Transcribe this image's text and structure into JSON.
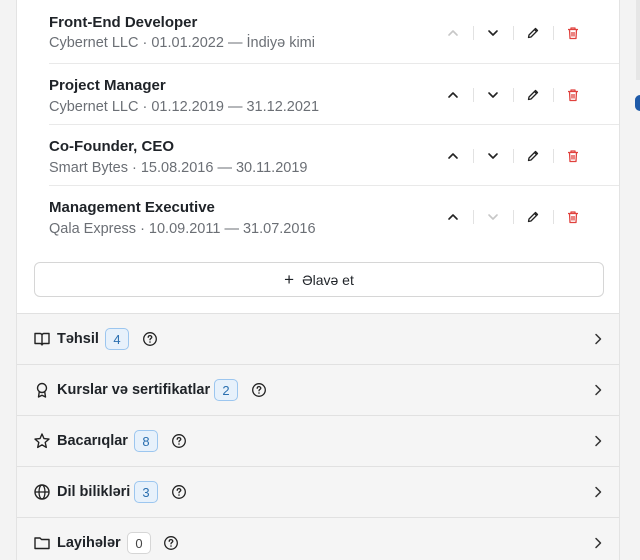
{
  "experience": {
    "items": [
      {
        "title": "Front-End Developer",
        "subtitle": "Cybernet LLC · 01.01.2022 — İndiyə kimi",
        "up_disabled": true,
        "down_disabled": false
      },
      {
        "title": "Project Manager",
        "subtitle": "Cybernet LLC · 01.12.2019 — 31.12.2021",
        "up_disabled": false,
        "down_disabled": false
      },
      {
        "title": "Co-Founder, CEO",
        "subtitle": "Smart Bytes · 15.08.2016 — 30.11.2019",
        "up_disabled": false,
        "down_disabled": false
      },
      {
        "title": "Management Executive",
        "subtitle": "Qala Express · 10.09.2011 — 31.07.2016",
        "up_disabled": false,
        "down_disabled": true
      }
    ],
    "add_label": "Əlavə et"
  },
  "sections": [
    {
      "label": "Təhsil",
      "count": "4",
      "icon": "book-icon"
    },
    {
      "label": "Kurslar və sertifikatlar",
      "count": "2",
      "icon": "award-icon"
    },
    {
      "label": "Bacarıqlar",
      "count": "8",
      "icon": "star-icon"
    },
    {
      "label": "Dil bilikləri",
      "count": "3",
      "icon": "globe-icon"
    },
    {
      "label": "Layihələr",
      "count": "0",
      "icon": "folder-icon"
    }
  ],
  "colors": {
    "delete": "#e0413d",
    "badge_border": "#9cc6ef",
    "badge_bg": "#e7f1fb",
    "badge_text": "#2a6fb0"
  }
}
